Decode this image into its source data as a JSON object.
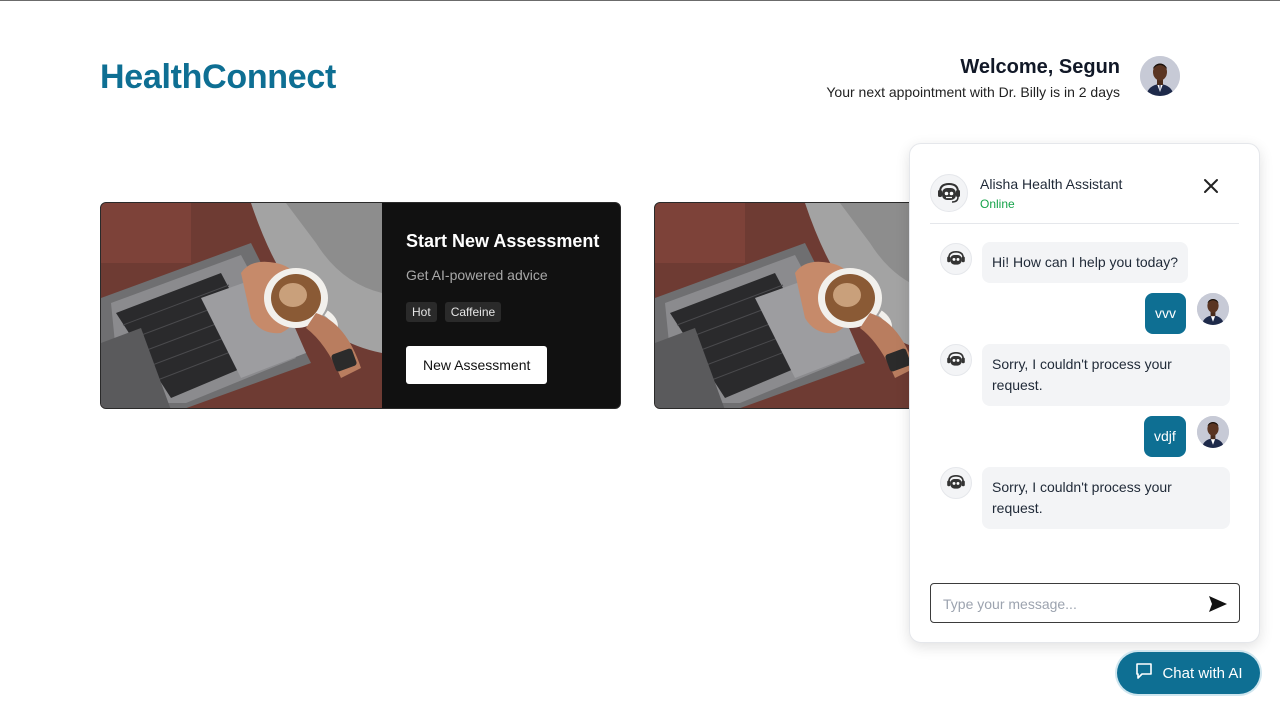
{
  "header": {
    "logo": "HealthConnect",
    "welcome_title": "Welcome, Segun",
    "welcome_sub": "Your next appointment with Dr. Billy is in 2 days",
    "avatar_icon": "user-avatar"
  },
  "cards": [
    {
      "title": "Start New Assessment",
      "description": "Get AI-powered advice",
      "tags": [
        "Hot",
        "Caffeine"
      ],
      "button": "New Assessment"
    }
  ],
  "chat": {
    "assistant_name": "Alisha Health Assistant",
    "status": "Online",
    "messages": [
      {
        "from": "bot",
        "text": "Hi! How can I help you today?"
      },
      {
        "from": "user",
        "text": "vvv"
      },
      {
        "from": "bot",
        "text": "Sorry, I couldn't process your request."
      },
      {
        "from": "user",
        "text": "vdjf"
      },
      {
        "from": "bot",
        "text": "Sorry, I couldn't process your request."
      }
    ],
    "input_placeholder": "Type your message...",
    "input_value": ""
  },
  "fab": {
    "label": "Chat with AI"
  },
  "colors": {
    "brand": "#0e6f93",
    "online": "#16a34a",
    "card_bg": "#111111"
  }
}
